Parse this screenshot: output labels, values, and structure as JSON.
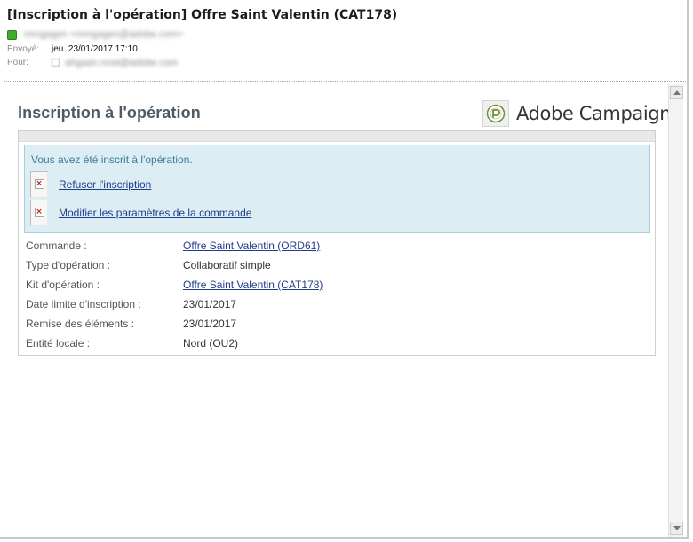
{
  "email": {
    "subject": "[Inscription à l'opération] Offre Saint Valentin  (CAT178)",
    "from_blurred": "mmgagen <mmgagen@adobe.com>",
    "sent_label": "Envoyé:",
    "sent_value": "jeu. 23/01/2017 17:10",
    "to_label": "Pour:",
    "to_blurred": "ahgaan.ncwi@adobe.com"
  },
  "body": {
    "title": "Inscription à l'opération",
    "brand_name": "Adobe Campaign",
    "notice": "Vous avez été inscrit à l'opération.",
    "actions": [
      {
        "label": "Refuser l'inscription"
      },
      {
        "label": "Modifier les paramètres de la commande"
      }
    ],
    "details": [
      {
        "label": "Commande :",
        "value": "Offre Saint Valentin (ORD61)",
        "link": true
      },
      {
        "label": "Type d'opération :",
        "value": "Collaboratif simple",
        "link": false
      },
      {
        "label": "Kit d'opération :",
        "value": "Offre Saint Valentin (CAT178)",
        "link": true
      },
      {
        "label": "Date limite d'inscription :",
        "value": "23/01/2017",
        "link": false
      },
      {
        "label": "Remise des éléments :",
        "value": "23/01/2017",
        "link": false
      },
      {
        "label": "Entité locale :",
        "value": "Nord (OU2)",
        "link": false
      }
    ]
  },
  "colors": {
    "title": "#4d5b66",
    "notice_bg": "#dcedf3",
    "notice_text": "#3b7d9b",
    "link": "#1f3d8c",
    "presence": "#3fae2a"
  },
  "icons": {
    "presence": "presence-status-icon",
    "brand": "adobe-campaign-logo-icon",
    "broken_image": "broken-image-icon"
  }
}
